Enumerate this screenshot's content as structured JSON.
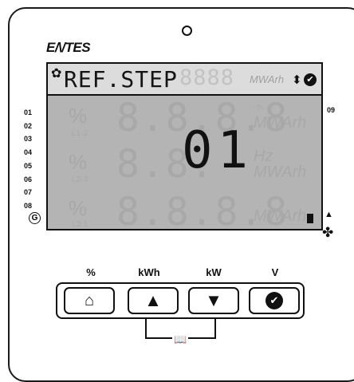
{
  "device": {
    "brand": "E/\\/TES"
  },
  "display": {
    "menu_title": "REF.STEP",
    "step_value": "01",
    "ghost_top_digits": "8888",
    "ghost_row_digits": "8.8.8.8",
    "top_unit": "MWArh",
    "rows": [
      {
        "pct": "%",
        "phase": "L1-2",
        "unit": "MWArh",
        "extra": "-?-"
      },
      {
        "pct": "%",
        "phase": "L2-3",
        "unit": "MWArh",
        "extra": "Hz"
      },
      {
        "pct": "%",
        "phase": "L3-1",
        "unit": "MWArh",
        "extra": ""
      }
    ]
  },
  "channels": {
    "left": [
      "01",
      "02",
      "03",
      "04",
      "05",
      "06",
      "07",
      "08"
    ],
    "right": "09",
    "g_label": "G"
  },
  "keys": {
    "labels": [
      "%",
      "kWh",
      "kW",
      "V"
    ],
    "items": [
      {
        "name": "home-key",
        "icon": "home-icon",
        "glyph": "🏠"
      },
      {
        "name": "up-key",
        "icon": "triangle-up-icon",
        "glyph": "▲"
      },
      {
        "name": "down-key",
        "icon": "triangle-down-icon",
        "glyph": "▼"
      },
      {
        "name": "enter-key",
        "icon": "check-icon",
        "glyph": "✔"
      }
    ],
    "combo_icon": "book-icon"
  }
}
